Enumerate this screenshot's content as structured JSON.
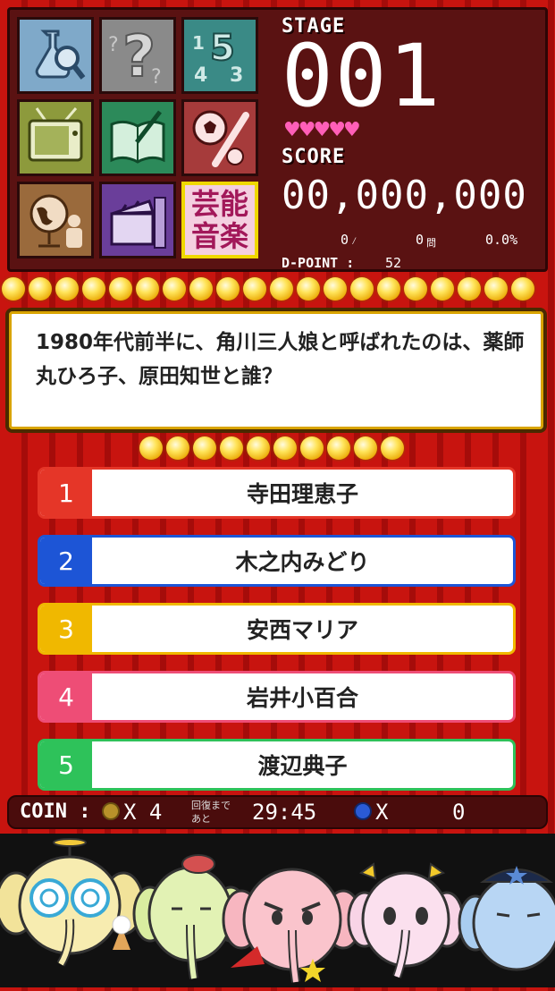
{
  "header": {
    "stage_label": "STAGE",
    "stage_value": "001",
    "score_label": "SCORE",
    "score_value": "00,000,000",
    "correct_count": "0",
    "correct_unit": "⁄",
    "question_count": "0",
    "question_unit": "問",
    "percent": "0.0%",
    "dpoint_label": "D-POINT :",
    "dpoint_value": "52",
    "hearts_count": 5
  },
  "categories": [
    {
      "name": "science-icon"
    },
    {
      "name": "question-icon"
    },
    {
      "name": "numbers-icon"
    },
    {
      "name": "tv-icon"
    },
    {
      "name": "book-icon"
    },
    {
      "name": "sports-icon"
    },
    {
      "name": "globe-icon"
    },
    {
      "name": "movie-icon"
    },
    {
      "name": "entertainment-music",
      "line1": "芸能",
      "line2": "音楽",
      "selected": true
    }
  ],
  "question": {
    "text": "1980年代前半に、角川三人娘と呼ばれたのは、薬師丸ひろ子、原田知世と誰？"
  },
  "answers": [
    {
      "num": "1",
      "text": "寺田理恵子",
      "color": "#e53628"
    },
    {
      "num": "2",
      "text": "木之内みどり",
      "color": "#1d55d6"
    },
    {
      "num": "3",
      "text": "安西マリア",
      "color": "#f0b800"
    },
    {
      "num": "4",
      "text": "岩井小百合",
      "color": "#ee4d76"
    },
    {
      "num": "5",
      "text": "渡辺典子",
      "color": "#2ec25a"
    }
  ],
  "status": {
    "coin_label": "COIN :",
    "coin_count": "X 4",
    "recover_label_1": "回復まで",
    "recover_label_2": "あと",
    "timer": "29:45",
    "gem_count": "X",
    "gem_value": "0"
  }
}
